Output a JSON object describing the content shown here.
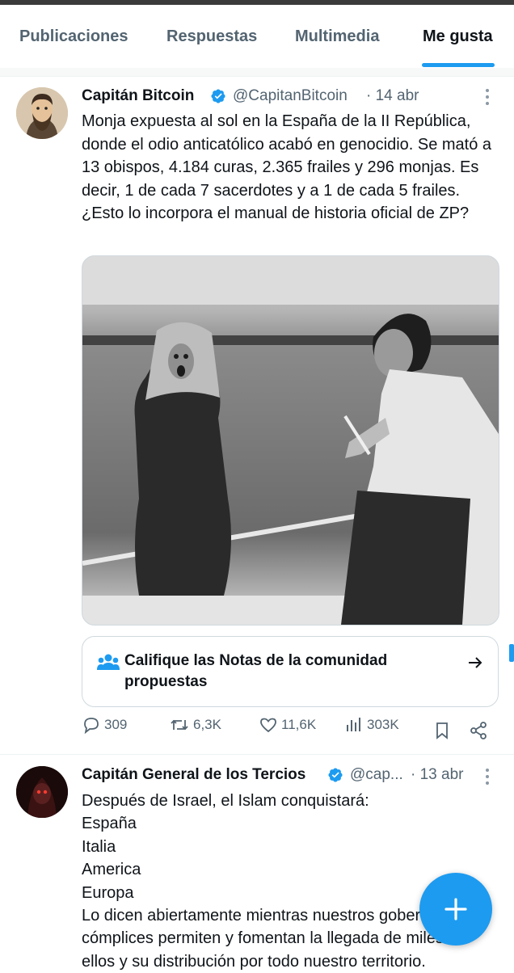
{
  "tabs": [
    {
      "label": "Publicaciones"
    },
    {
      "label": "Respuestas"
    },
    {
      "label": "Multimedia"
    },
    {
      "label": "Me gusta"
    }
  ],
  "posts": [
    {
      "name": "Capitán Bitcoin",
      "handle": "@CapitanBitcoin",
      "date": "· 14 abr",
      "verified": true,
      "text": "Monja expuesta al sol en la España de la II República, donde el odio anticatólico acabó en genocidio. Se mató a 13 obispos, 4.184 curas, 2.365 frailes y 296 monjas. Es decir, 1 de cada 7 sacerdotes y a 1 de cada 5 frailes. ¿Esto lo incorpora el manual de historia oficial de ZP?",
      "community_notes": "Califique las Notas de la comunidad propuestas",
      "stats": {
        "replies": "309",
        "reposts": "6,3K",
        "likes": "11,6K",
        "views": "303K"
      }
    },
    {
      "name": "Capitán General de los Tercios",
      "handle": "@cap...",
      "date": "· 13 abr",
      "verified": true,
      "lines": [
        "Después de Israel, el Islam conquistará:",
        "España",
        "Italia",
        "America",
        "Europa",
        "Lo dicen abiertamente mientras nuestros gobernantes",
        "cómplices permiten y fomentan la llegada de miles de",
        "ellos y su distribución por todo nuestro territorio."
      ]
    }
  ],
  "colors": {
    "accent": "#1d9bf0",
    "text": "#0f1419",
    "muted": "#536471"
  },
  "icons": [
    "reply-icon",
    "repost-icon",
    "like-icon",
    "views-icon",
    "bookmark-icon",
    "share-icon",
    "community-notes-icon",
    "arrow-right-icon",
    "verified-icon",
    "more-icon",
    "compose-icon"
  ]
}
